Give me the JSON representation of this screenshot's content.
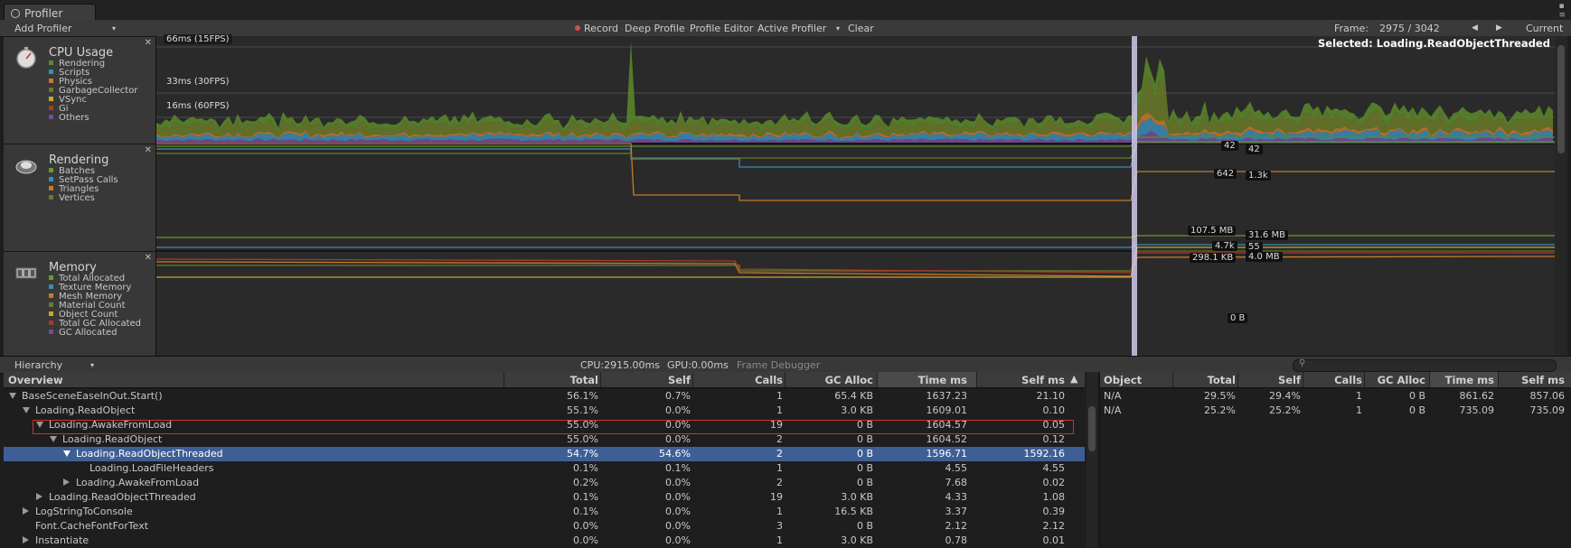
{
  "window": {
    "tab_title": "Profiler"
  },
  "toolbar": {
    "add_profiler": "Add Profiler",
    "record": "Record",
    "deep_profile": "Deep Profile",
    "profile_editor": "Profile Editor",
    "active_profiler": "Active Profiler",
    "clear": "Clear",
    "frame_label": "Frame:",
    "frame_value": "2975 / 3042",
    "current": "Current"
  },
  "selected_label": "Selected: Loading.ReadObjectThreaded",
  "panels": [
    {
      "title": "CPU Usage",
      "icon": "stopwatch-icon",
      "legend": [
        {
          "name": "Rendering",
          "color": "#5a8a2a"
        },
        {
          "name": "Scripts",
          "color": "#3a8cb8"
        },
        {
          "name": "Physics",
          "color": "#c87a2a"
        },
        {
          "name": "GarbageCollector",
          "color": "#6a7a2a"
        },
        {
          "name": "VSync",
          "color": "#c8a82a"
        },
        {
          "name": "Gi",
          "color": "#a83a2a"
        },
        {
          "name": "Others",
          "color": "#7a4a9a"
        }
      ]
    },
    {
      "title": "Rendering",
      "icon": "rendering-icon",
      "legend": [
        {
          "name": "Batches",
          "color": "#6a9a2a"
        },
        {
          "name": "SetPass Calls",
          "color": "#3a8cb8"
        },
        {
          "name": "Triangles",
          "color": "#c87a2a"
        },
        {
          "name": "Vertices",
          "color": "#6a7a2a"
        }
      ]
    },
    {
      "title": "Memory",
      "icon": "memory-chip-icon",
      "legend": [
        {
          "name": "Total Allocated",
          "color": "#6a9a2a"
        },
        {
          "name": "Texture Memory",
          "color": "#3a8cb8"
        },
        {
          "name": "Mesh Memory",
          "color": "#c87a2a"
        },
        {
          "name": "Material Count",
          "color": "#6a7a2a"
        },
        {
          "name": "Object Count",
          "color": "#c8a82a"
        },
        {
          "name": "Total GC Allocated",
          "color": "#a83a2a"
        },
        {
          "name": "GC Allocated",
          "color": "#7a4a9a"
        }
      ]
    }
  ],
  "cpu_chart": {
    "lines": [
      "66ms (15FPS)",
      "33ms (30FPS)",
      "16ms (60FPS)"
    ]
  },
  "rendering_chart": {
    "labels_left": [
      "42",
      "642"
    ],
    "labels_right": [
      "42",
      "1.3k"
    ]
  },
  "memory_chart": {
    "labels_left": [
      "107.5 MB",
      "4.7k",
      "298.1 KB",
      "0 B"
    ],
    "labels_right": [
      "31.6 MB",
      "55",
      "4.0 MB"
    ]
  },
  "bottom_toolbar": {
    "view": "Hierarchy",
    "cpu": "CPU:2915.00ms",
    "gpu": "GPU:0.00ms",
    "frame_debugger": "Frame Debugger"
  },
  "hierarchy": {
    "columns": [
      "Overview",
      "Total",
      "Self",
      "Calls",
      "GC Alloc",
      "Time ms",
      "Self ms"
    ],
    "rows": [
      {
        "name": "BaseSceneEaseInOut.Start()",
        "indent": 0,
        "expander": "down",
        "total": "56.1%",
        "self": "0.7%",
        "calls": "1",
        "gc": "65.4 KB",
        "time": "1637.23",
        "selfms": "21.10"
      },
      {
        "name": "Loading.ReadObject",
        "indent": 1,
        "expander": "down",
        "total": "55.1%",
        "self": "0.0%",
        "calls": "1",
        "gc": "3.0 KB",
        "time": "1609.01",
        "selfms": "0.10"
      },
      {
        "name": "Loading.AwakeFromLoad",
        "indent": 2,
        "expander": "down",
        "total": "55.0%",
        "self": "0.0%",
        "calls": "19",
        "gc": "0 B",
        "time": "1604.57",
        "selfms": "0.05"
      },
      {
        "name": "Loading.ReadObject",
        "indent": 3,
        "expander": "down",
        "total": "55.0%",
        "self": "0.0%",
        "calls": "2",
        "gc": "0 B",
        "time": "1604.52",
        "selfms": "0.12"
      },
      {
        "name": "Loading.ReadObjectThreaded",
        "indent": 4,
        "expander": "down",
        "total": "54.7%",
        "self": "54.6%",
        "calls": "2",
        "gc": "0 B",
        "time": "1596.71",
        "selfms": "1592.16",
        "selected": true
      },
      {
        "name": "Loading.LoadFileHeaders",
        "indent": 5,
        "expander": "none",
        "total": "0.1%",
        "self": "0.1%",
        "calls": "1",
        "gc": "0 B",
        "time": "4.55",
        "selfms": "4.55"
      },
      {
        "name": "Loading.AwakeFromLoad",
        "indent": 4,
        "expander": "right",
        "total": "0.2%",
        "self": "0.0%",
        "calls": "2",
        "gc": "0 B",
        "time": "7.68",
        "selfms": "0.02"
      },
      {
        "name": "Loading.ReadObjectThreaded",
        "indent": 2,
        "expander": "right",
        "total": "0.1%",
        "self": "0.0%",
        "calls": "19",
        "gc": "3.0 KB",
        "time": "4.33",
        "selfms": "1.08"
      },
      {
        "name": "LogStringToConsole",
        "indent": 1,
        "expander": "right",
        "total": "0.1%",
        "self": "0.0%",
        "calls": "1",
        "gc": "16.5 KB",
        "time": "3.37",
        "selfms": "0.39"
      },
      {
        "name": "Font.CacheFontForText",
        "indent": 1,
        "expander": "none",
        "total": "0.0%",
        "self": "0.0%",
        "calls": "3",
        "gc": "0 B",
        "time": "2.12",
        "selfms": "2.12"
      },
      {
        "name": "Instantiate",
        "indent": 1,
        "expander": "right",
        "total": "0.0%",
        "self": "0.0%",
        "calls": "1",
        "gc": "3.0 KB",
        "time": "0.78",
        "selfms": "0.01"
      }
    ]
  },
  "objects": {
    "columns": [
      "Object",
      "Total",
      "Self",
      "Calls",
      "GC Alloc",
      "Time ms",
      "Self ms"
    ],
    "rows": [
      {
        "object": "N/A",
        "total": "29.5%",
        "self": "29.4%",
        "calls": "1",
        "gc": "0 B",
        "time": "861.62",
        "selfms": "857.06"
      },
      {
        "object": "N/A",
        "total": "25.2%",
        "self": "25.2%",
        "calls": "1",
        "gc": "0 B",
        "time": "735.09",
        "selfms": "735.09"
      }
    ]
  }
}
